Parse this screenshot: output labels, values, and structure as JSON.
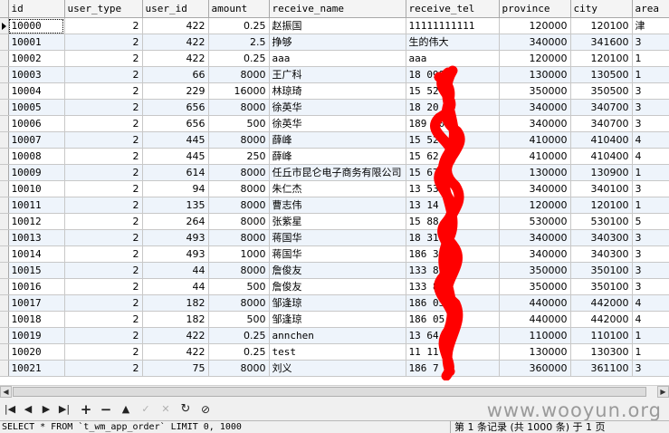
{
  "grid": {
    "columns": [
      "id",
      "user_type",
      "user_id",
      "amount",
      "receive_name",
      "receive_tel",
      "province",
      "city",
      "area"
    ],
    "rows": [
      [
        "10000",
        "2",
        "422",
        "0.25",
        "赵振国",
        "11111111111",
        "120000",
        "120100",
        "津"
      ],
      [
        "10001",
        "2",
        "422",
        "2.5",
        "挣够",
        "生的伟大",
        "340000",
        "341600",
        "3"
      ],
      [
        "10002",
        "2",
        "422",
        "0.25",
        "aaa",
        "aaa",
        "120000",
        "120100",
        "1"
      ],
      [
        "10003",
        "2",
        "66",
        "8000",
        "王广科",
        "18   098",
        "130000",
        "130500",
        "1"
      ],
      [
        "10004",
        "2",
        "229",
        "16000",
        "林琼琦",
        "15    52",
        "350000",
        "350500",
        "3"
      ],
      [
        "10005",
        "2",
        "656",
        "8000",
        "徐英华",
        "18    20",
        "340000",
        "340700",
        "3"
      ],
      [
        "10006",
        "2",
        "656",
        "500",
        "徐英华",
        "189    20",
        "340000",
        "340700",
        "3"
      ],
      [
        "10007",
        "2",
        "445",
        "8000",
        "薛峰",
        "15    52",
        "410000",
        "410400",
        "4"
      ],
      [
        "10008",
        "2",
        "445",
        "250",
        "薛峰",
        "15    62",
        "410000",
        "410400",
        "4"
      ],
      [
        "10009",
        "2",
        "614",
        "8000",
        "任丘市昆仑电子商务有限公司",
        "15    67",
        "130000",
        "130900",
        "1"
      ],
      [
        "10010",
        "2",
        "94",
        "8000",
        "朱仁杰",
        "13    53",
        "340000",
        "340100",
        "3"
      ],
      [
        "10011",
        "2",
        "135",
        "8000",
        "曹志伟",
        "13    14",
        "120000",
        "120100",
        "1"
      ],
      [
        "10012",
        "2",
        "264",
        "8000",
        "张紫星",
        "15    88",
        "530000",
        "530100",
        "5"
      ],
      [
        "10013",
        "2",
        "493",
        "8000",
        "蒋国华",
        "18    31",
        "340000",
        "340300",
        "3"
      ],
      [
        "10014",
        "2",
        "493",
        "1000",
        "蒋国华",
        "186    31",
        "340000",
        "340300",
        "3"
      ],
      [
        "10015",
        "2",
        "44",
        "8000",
        "詹俊友",
        "133    85",
        "350000",
        "350100",
        "3"
      ],
      [
        "10016",
        "2",
        "44",
        "500",
        "詹俊友",
        "133    85",
        "350000",
        "350100",
        "3"
      ],
      [
        "10017",
        "2",
        "182",
        "8000",
        "邹逢琼",
        "186    05",
        "440000",
        "442000",
        "4"
      ],
      [
        "10018",
        "2",
        "182",
        "500",
        "邹逢琼",
        "186    05",
        "440000",
        "442000",
        "4"
      ],
      [
        "10019",
        "2",
        "422",
        "0.25",
        "annchen",
        "13    64",
        "110000",
        "110100",
        "1"
      ],
      [
        "10020",
        "2",
        "422",
        "0.25",
        "test",
        "11    11",
        "130000",
        "130300",
        "1"
      ],
      [
        "10021",
        "2",
        "75",
        "8000",
        "刘义",
        "186    7",
        "360000",
        "361100",
        "3"
      ]
    ]
  },
  "navbar": {
    "first": "|◀",
    "prev": "◀",
    "next": "▶",
    "last": "▶|",
    "add": "+",
    "delete": "−",
    "up": "▲",
    "apply": "✓",
    "cancel": "✕",
    "refresh": "↻",
    "stop": "⊘"
  },
  "watermark": "www.wooyun.org",
  "status": {
    "sql": "SELECT * FROM `t_wm_app_order` LIMIT 0, 1000",
    "record": "第 1 条记录 (共 1000 条) 于 1 页"
  },
  "colors": {
    "scribble": "#ff0000",
    "alt_row": "#eef4fb"
  }
}
